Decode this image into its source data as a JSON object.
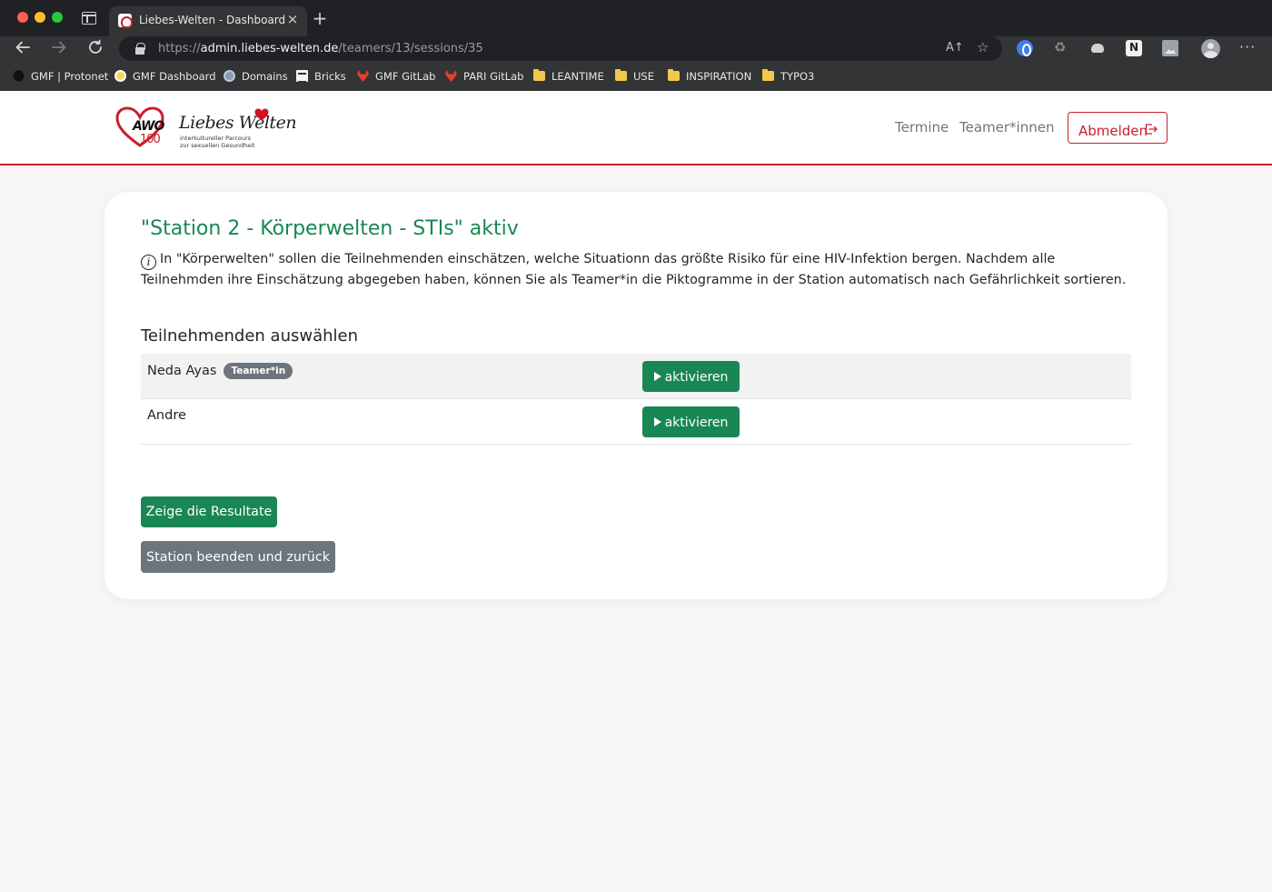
{
  "browser": {
    "tab_title": "Liebes-Welten - Dashboard",
    "tab_close": "×",
    "new_tab": "+",
    "url_scheme": "https://",
    "url_host": "admin.liebes-welten.de",
    "url_path": "/teamers/13/sessions/35",
    "read_aloud_icon": "A↑",
    "favorites_icon": "☆",
    "bookmarks": [
      {
        "label": "GMF | Protonet",
        "icon": "hexagon-icon"
      },
      {
        "label": "GMF Dashboard",
        "icon": "circle-icon"
      },
      {
        "label": "Domains",
        "icon": "globe-icon"
      },
      {
        "label": "Bricks",
        "icon": "bricks-icon"
      },
      {
        "label": "GMF GitLab",
        "icon": "gitlab-icon"
      },
      {
        "label": "PARI GitLab",
        "icon": "gitlab-icon"
      },
      {
        "label": "LEANTIME",
        "icon": "folder-icon"
      },
      {
        "label": "USE",
        "icon": "folder-icon"
      },
      {
        "label": "INSPIRATION",
        "icon": "folder-icon"
      },
      {
        "label": "TYPO3",
        "icon": "folder-icon"
      }
    ]
  },
  "site": {
    "logo_awo": "AWO",
    "logo_100": "100",
    "logo_script": "Liebes Welten",
    "logo_tag1": "interkultureller Parcours",
    "logo_tag2": "zur sexuellen Gesundheit",
    "nav": {
      "termine": "Termine",
      "teamer": "Teamer*innen",
      "logout": "Abmelden"
    },
    "brand_red": "#c8202c",
    "success_green": "#198754",
    "secondary_gray": "#6c757d"
  },
  "main": {
    "title": "\"Station 2 - Körperwelten - STIs\" aktiv",
    "info_icon": "i",
    "info_text": "In \"Körperwelten\" sollen die Teilnehmenden einschätzen, welche Situationn das größte Risiko für eine HIV-Infektion bergen. Nachdem alle Teilnehmden ihre Einschätzung abgegeben haben, können Sie als Teamer*in die Piktogramme in der Station automatisch nach Gefährlichkeit sortieren.",
    "section_title": "Teilnehmenden auswählen",
    "participants": [
      {
        "name": "Neda Ayas",
        "badge": "Teamer*in",
        "action": "aktivieren"
      },
      {
        "name": "Andre",
        "badge": "",
        "action": "aktivieren"
      }
    ],
    "results_button": "Zeige die Resultate",
    "end_button": "Station beenden und zurück"
  }
}
